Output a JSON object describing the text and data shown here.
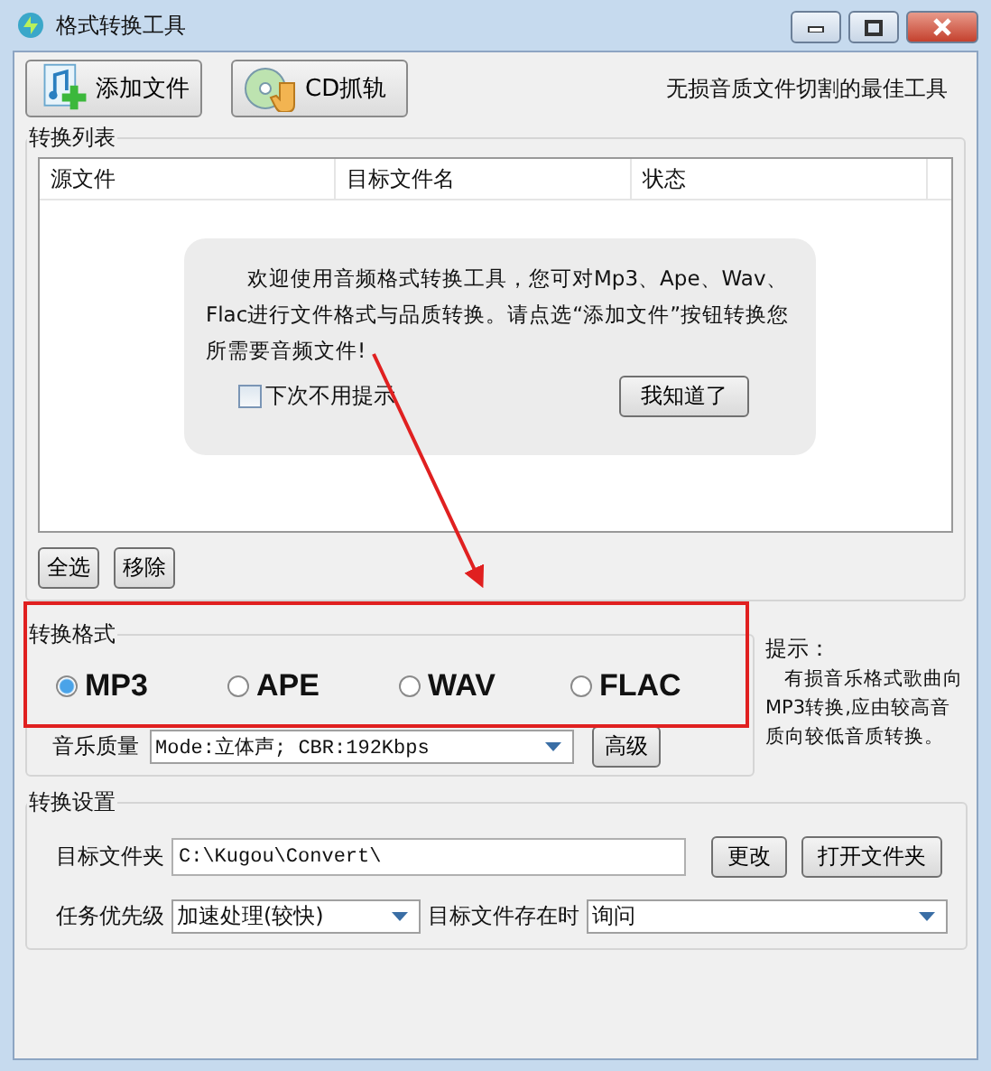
{
  "window": {
    "title": "格式转换工具"
  },
  "toolbar": {
    "buttons": [
      {
        "label": "添加文件",
        "kind": "add"
      },
      {
        "label": "CD抓轨",
        "kind": "cd"
      }
    ],
    "tagline": "无损音质文件切割的最佳工具"
  },
  "conversion_list": {
    "title": "转换列表",
    "columns": [
      "源文件",
      "目标文件名",
      "状态"
    ],
    "dialog": {
      "message": "欢迎使用音频格式转换工具，您可对Mp3、Ape、Wav、Flac进行文件格式与品质转换。请点选“添加文件”按钮转换您所需要音频文件!",
      "checkbox": {
        "label": "下次不用提示",
        "checked": false
      },
      "button": "我知道了"
    },
    "buttons": [
      "全选",
      "移除"
    ]
  },
  "format": {
    "title": "转换格式",
    "options": [
      {
        "label": "MP3",
        "selected": true
      },
      {
        "label": "APE",
        "selected": false
      },
      {
        "label": "WAV",
        "selected": false
      },
      {
        "label": "FLAC",
        "selected": false
      }
    ],
    "quality_label": "音乐质量",
    "quality_value": "Mode:立体声; CBR:192Kbps",
    "advanced_button": "高级",
    "tip_title": "提示：",
    "tip": "有损音乐格式歌曲向MP3转换,应由较高音质向较低音质转换。"
  },
  "settings": {
    "title": "转换设置",
    "folder_label": "目标文件夹",
    "folder_value": "C:\\Kugou\\Convert\\",
    "change_button": "更改",
    "open_button": "打开文件夹",
    "priority_label": "任务优先级",
    "priority_value": "加速处理(较快)",
    "exists_label": "目标文件存在时",
    "exists_value": "询问"
  }
}
